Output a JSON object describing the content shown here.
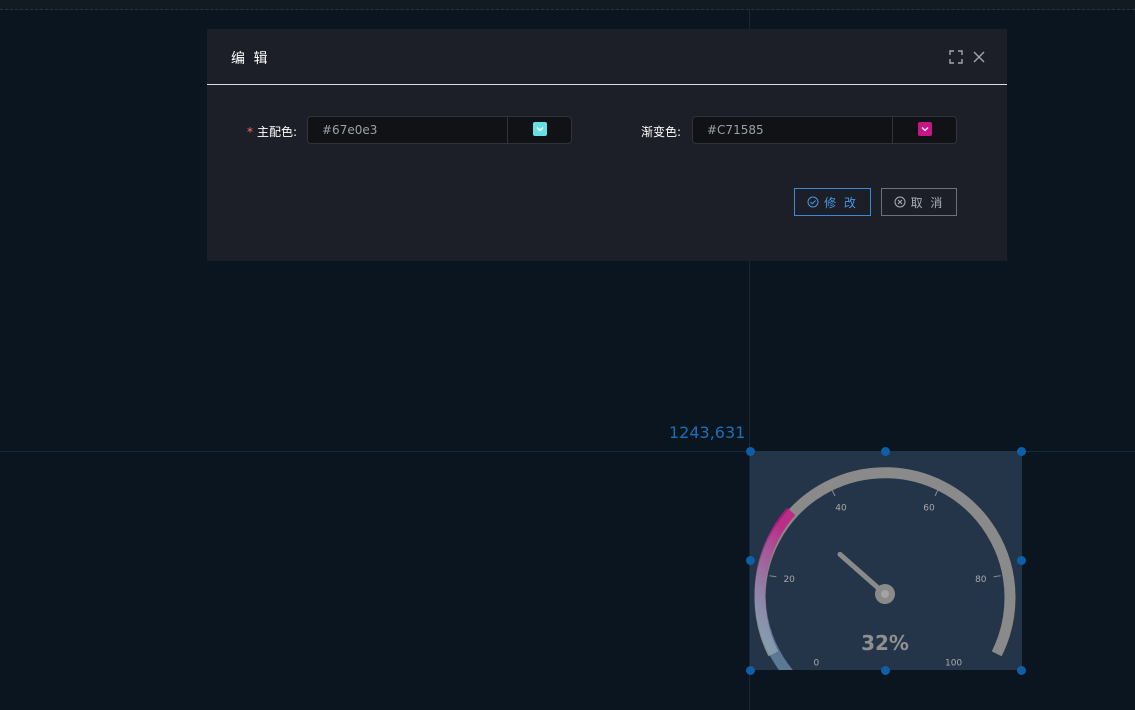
{
  "dialog": {
    "title": "编 辑",
    "primary_color": {
      "required_mark": "*",
      "label": "主配色:",
      "value": "#67e0e3",
      "swatch_color": "#67e0e3"
    },
    "gradient_color": {
      "label": "渐变色:",
      "value": "#C71585",
      "swatch_color": "#C71585"
    },
    "confirm_label": "修 改",
    "cancel_label": "取 消",
    "icons": {
      "fullscreen": "fullscreen-icon",
      "close": "close-icon",
      "confirm": "check-circle-icon",
      "cancel": "close-circle-icon",
      "dropdown": "chevron-down-icon"
    }
  },
  "canvas": {
    "coordinate_readout": "1243,631"
  },
  "gauge": {
    "value": 32,
    "value_label": "32%",
    "min": 0,
    "max": 100,
    "tick_labels": [
      "0",
      "20",
      "40",
      "60",
      "80",
      "100"
    ],
    "colors": {
      "track": "#8a8a8a",
      "gradient_start": "#67e0e3",
      "gradient_end": "#C71585",
      "background": "#243549"
    }
  }
}
